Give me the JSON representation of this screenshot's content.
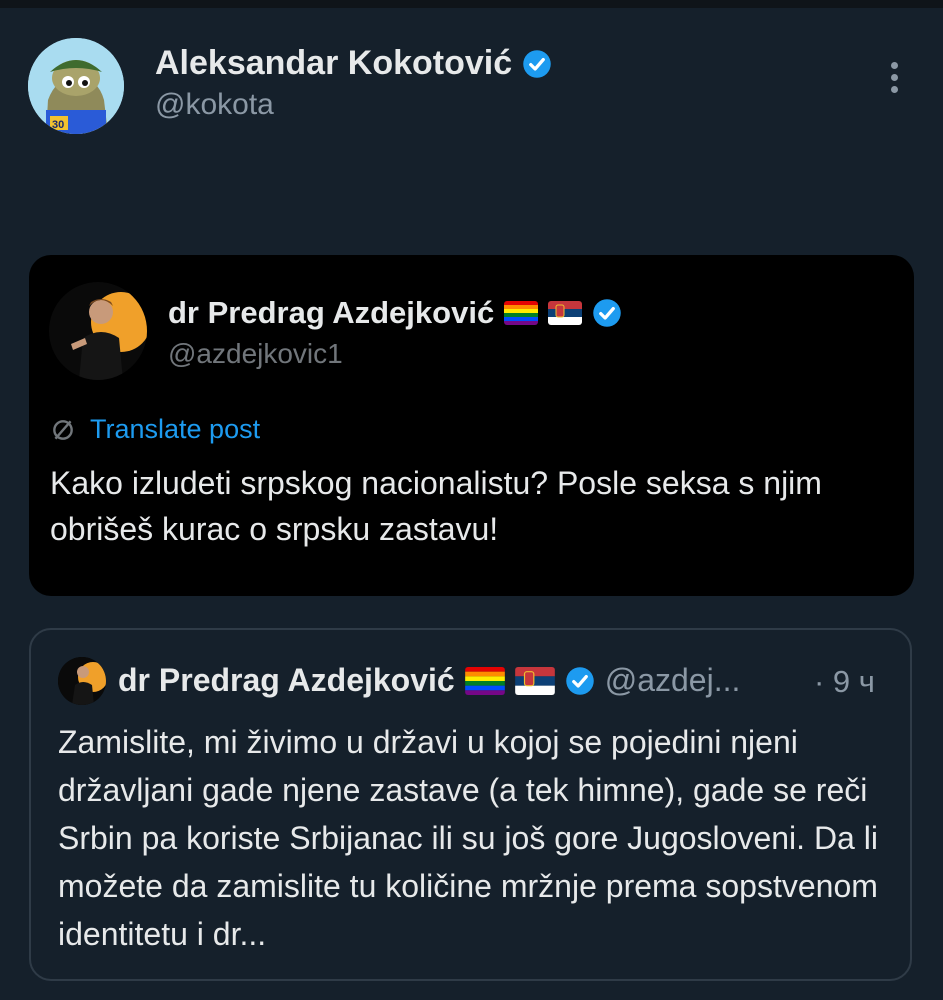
{
  "post": {
    "author_name": "Aleksandar Kokotović",
    "author_handle": "@kokota",
    "avatar_badge": "30"
  },
  "quoted_post": {
    "author_name": "dr Predrag Azdejković",
    "author_handle": "@azdejkovic1",
    "translate_label": "Translate post",
    "text": "Kako izludeti srpskog nacionalistu? Posle seksa s njim obrišeš kurac o srpsku zastavu!"
  },
  "nested_quote": {
    "author_name": "dr Predrag Azdejković",
    "author_handle": "@azdej...",
    "time": "· 9 ч",
    "text": "Zamislite, mi živimo u državi u kojoj se pojedini njeni državljani gade njene zastave (a tek himne), gade se reči Srbin pa koriste Srbijanac ili su još gore Jugosloveni. Da li možete da zamislite tu količine mržnje prema sopstvenom identitetu i dr..."
  },
  "colors": {
    "background": "#15202b",
    "card_background": "#000000",
    "accent_blue": "#1d9bf0",
    "muted_text": "#8b98a5"
  },
  "icons": [
    "verified-badge-icon",
    "more-options-icon",
    "translate-icon",
    "pride-flag-icon",
    "serbia-flag-icon"
  ]
}
